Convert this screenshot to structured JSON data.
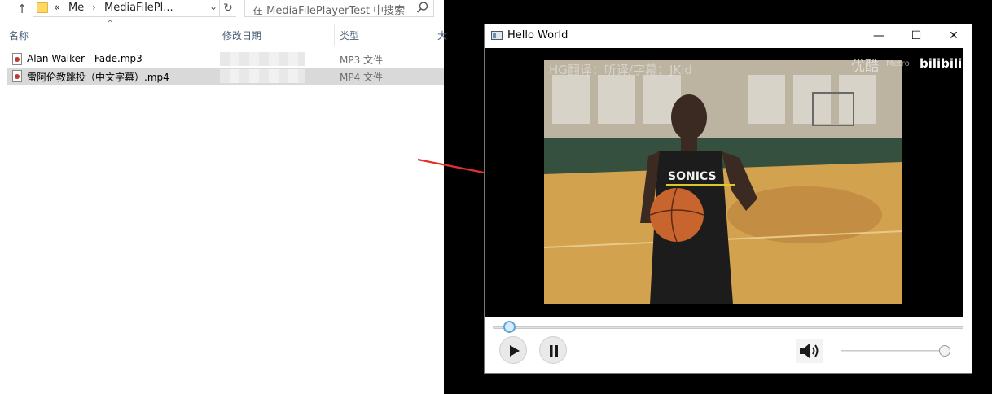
{
  "explorer": {
    "breadcrumb": {
      "prefix": "«",
      "path": [
        "Me",
        "MediaFilePl..."
      ]
    },
    "search": {
      "placeholder": "在 MediaFilePlayerTest 中搜索"
    },
    "columns": [
      "名称",
      "修改日期",
      "类型",
      "大"
    ],
    "files": [
      {
        "name": "Alan Walker - Fade.mp3",
        "type": "MP3 文件",
        "selected": false
      },
      {
        "name": "雷阿伦教跳投（中文字幕）.mp4",
        "type": "MP4 文件",
        "selected": true
      }
    ]
  },
  "player": {
    "title": "Hello World",
    "window_buttons": {
      "minimize": "—",
      "maximize": "☐",
      "close": "✕"
    },
    "video": {
      "subtitle_overlay": "HG翻译：听译/字幕：JKid",
      "logo_youku": "优酷",
      "logo_metro": "Metro",
      "logo_bili": "bilibili",
      "jersey_text": "SONICS"
    },
    "seek_position": 0.02,
    "volume_level": 0.98,
    "state": "playing"
  },
  "colors": {
    "arrow": "#e8302a",
    "selection": "#d9d9d9",
    "seek_accent": "#5aa6d8"
  }
}
